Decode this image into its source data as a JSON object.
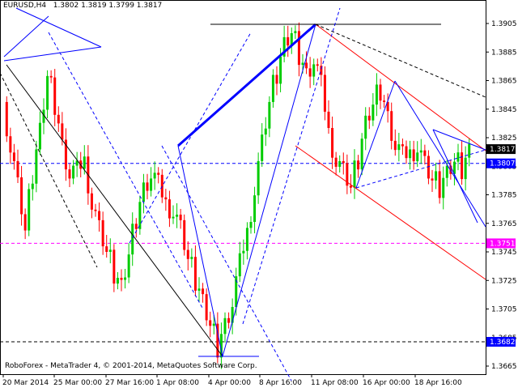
{
  "header": {
    "symbol": "EURUSD,H4",
    "ohlc": "1.3802 1.3819 1.3799 1.3817"
  },
  "footer": {
    "copyright": "RoboForex - MetaTrader 4, © 2001-2014, MetaQuotes Software Corp."
  },
  "colors": {
    "candle_up": "#00cc00",
    "candle_down": "#ff0000",
    "forecast_blue": "#0000ff",
    "channel_red": "#ff0000",
    "support_magenta": "#ff00ff",
    "price_tag_blue": "#0000ff"
  },
  "chart_data": {
    "type": "candlestick",
    "title": "EURUSD,H4",
    "ylim": [
      1.366,
      1.391
    ],
    "y_ticks": [
      "1.3905",
      "1.3885",
      "1.3865",
      "1.3845",
      "1.3825",
      "1.3805",
      "1.3785",
      "1.3765",
      "1.3745",
      "1.3725",
      "1.3705",
      "1.3685",
      "1.3665"
    ],
    "x_ticks": [
      "20 Mar 2014",
      "25 Mar 00:00",
      "27 Mar 16:00",
      "1 Apr 08:00",
      "4 Apr 00:00",
      "8 Apr 16:00",
      "11 Apr 08:00",
      "16 Apr 00:00",
      "18 Apr 16:00"
    ],
    "price_labels": [
      {
        "label": "1.3817",
        "value": 1.3817,
        "style": "current"
      },
      {
        "label": "1.3807",
        "value": 1.3807,
        "style": "level"
      },
      {
        "label": "1.3751",
        "value": 1.3751,
        "style": "level"
      },
      {
        "label": "1.3682",
        "value": 1.3682,
        "style": "level"
      }
    ],
    "levels": [
      {
        "value": 1.3807,
        "color": "#0000ff",
        "style": "dashed"
      },
      {
        "value": 1.3751,
        "color": "#ff00ff",
        "style": "dashed"
      },
      {
        "value": 1.3682,
        "color": "#000000",
        "style": "dashed"
      }
    ],
    "close_path": [
      1.385,
      1.382,
      1.379,
      1.376,
      1.38,
      1.383,
      1.387,
      1.385,
      1.382,
      1.38,
      1.38,
      1.381,
      1.378,
      1.376,
      1.3745,
      1.373,
      1.372,
      1.3745,
      1.377,
      1.379,
      1.38,
      1.379,
      1.378,
      1.3775,
      1.376,
      1.374,
      1.3725,
      1.371,
      1.3695,
      1.368,
      1.3695,
      1.371,
      1.3735,
      1.376,
      1.379,
      1.382,
      1.385,
      1.387,
      1.389,
      1.39,
      1.3885,
      1.387,
      1.388,
      1.386,
      1.383,
      1.381,
      1.38,
      1.379,
      1.381,
      1.3835,
      1.385,
      1.386,
      1.384,
      1.382,
      1.381,
      1.3815,
      1.382,
      1.3805,
      1.3795,
      1.379,
      1.38,
      1.381,
      1.3805,
      1.3817
    ]
  }
}
